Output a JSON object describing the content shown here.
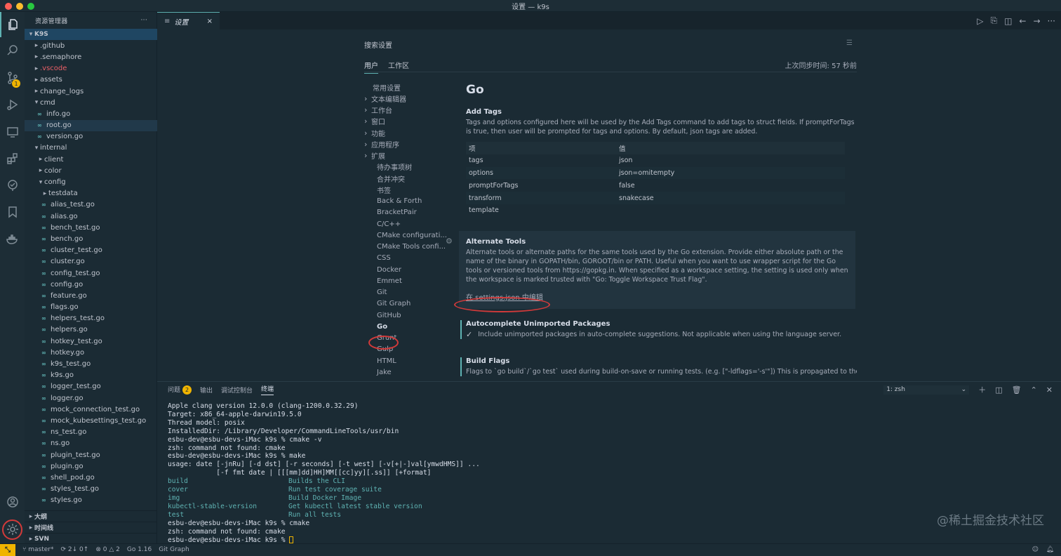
{
  "window": {
    "title": "设置 — k9s"
  },
  "explorer": {
    "header": "资源管理器",
    "more": "···",
    "root": "K9S",
    "items": [
      ".github",
      ".semaphore",
      ".vscode",
      "assets",
      "change_logs",
      "cmd",
      "info.go",
      "root.go",
      "version.go",
      "internal",
      "client",
      "color",
      "config",
      "testdata",
      "alias_test.go",
      "alias.go",
      "bench_test.go",
      "bench.go",
      "cluster_test.go",
      "cluster.go",
      "config_test.go",
      "config.go",
      "feature.go",
      "flags.go",
      "helpers_test.go",
      "helpers.go",
      "hotkey_test.go",
      "hotkey.go",
      "k9s_test.go",
      "k9s.go",
      "logger_test.go",
      "logger.go",
      "mock_connection_test.go",
      "mock_kubesettings_test.go",
      "ns_test.go",
      "ns.go",
      "plugin_test.go",
      "plugin.go",
      "shell_pod.go",
      "styles_test.go",
      "styles.go"
    ],
    "sections": [
      "大纲",
      "时间线",
      "SVN"
    ]
  },
  "activity": {
    "scm_badge": "1"
  },
  "editor": {
    "tab_label": "设置",
    "tab_close": "×"
  },
  "settings": {
    "search_placeholder": "搜索设置",
    "tab_user": "用户",
    "tab_workspace": "工作区",
    "sync_status": "上次同步时间: 57 秒前",
    "toc": [
      "常用设置",
      "文本编辑器",
      "工作台",
      "窗口",
      "功能",
      "应用程序",
      "扩展",
      "待办事项树",
      "合并冲突",
      "书签",
      "Back & Forth",
      "BracketPair",
      "C/C++",
      "CMake configurati...",
      "CMake Tools confi...",
      "CSS",
      "Docker",
      "Emmet",
      "Git",
      "Git Graph",
      "GitHub",
      "Go",
      "Grunt",
      "Gulp",
      "HTML",
      "Jake"
    ],
    "section_title": "Go",
    "add_tags": {
      "title": "Add Tags",
      "description": "Tags and options configured here will be used by the Add Tags command to add tags to struct fields. If promptForTags is true, then user will be prompted for tags and options. By default, json tags are added.",
      "col_key": "项",
      "col_value": "值",
      "rows": [
        {
          "k": "tags",
          "v": "json"
        },
        {
          "k": "options",
          "v": "json=omitempty"
        },
        {
          "k": "promptForTags",
          "v": "false"
        },
        {
          "k": "transform",
          "v": "snakecase"
        },
        {
          "k": "template",
          "v": ""
        }
      ]
    },
    "alternate_tools": {
      "title": "Alternate Tools",
      "description": "Alternate tools or alternate paths for the same tools used by the Go extension. Provide either absolute path or the name of the binary in GOPATH/bin, GOROOT/bin or PATH. Useful when you want to use wrapper script for the Go tools or versioned tools from https://gopkg.in. When specified as a workspace setting, the setting is used only when the workspace is marked trusted with \"Go: Toggle Workspace Trust Flag\".",
      "link": "在 settings.json 中编辑"
    },
    "autocomplete": {
      "title": "Autocomplete Unimported Packages",
      "checkbox_label": "Include unimported packages in auto-complete suggestions. Not applicable when using the language server."
    },
    "build_flags": {
      "title": "Build Flags",
      "description": "Flags to `go build`/`go test` used during build-on-save or running tests. (e.g. [\"-ldflags='-s'\"]) This is propagated to the"
    }
  },
  "panel": {
    "tabs": [
      "问题",
      "输出",
      "调试控制台",
      "终端"
    ],
    "problems_count": "2",
    "shell": "1: zsh",
    "terminal_lines": [
      "Apple clang version 12.0.0 (clang-1200.0.32.29)",
      "Target: x86_64-apple-darwin19.5.0",
      "Thread model: posix",
      "InstalledDir: /Library/Developer/CommandLineTools/usr/bin",
      "esbu-dev@esbu-devs-iMac k9s % cmake -v",
      "zsh: command not found: cmake",
      "esbu-dev@esbu-devs-iMac k9s % make",
      "usage: date [-jnRu] [-d dst] [-r seconds] [-t west] [-v[+|-]val[ymwdHMS]] ...",
      "            [-f fmt date | [[[mm]dd]HH]MM[[cc]yy][.ss]] [+format]"
    ],
    "make_targets": [
      {
        "name": "build",
        "desc": "Builds the CLI"
      },
      {
        "name": "cover",
        "desc": "Run test coverage suite"
      },
      {
        "name": "img",
        "desc": "Build Docker Image"
      },
      {
        "name": "kubectl-stable-version",
        "desc": "Get kubectl latest stable version"
      },
      {
        "name": "test",
        "desc": "Run all tests"
      }
    ],
    "terminal_tail": [
      "esbu-dev@esbu-devs-iMac k9s % cmake",
      "zsh: command not found: cmake",
      "esbu-dev@esbu-devs-iMac k9s % "
    ]
  },
  "watermark": "@稀土掘金技术社区",
  "statusbar": {
    "branch": "master*",
    "sync": "2↓ 0↑",
    "errors": "0",
    "warnings": "2",
    "go_version": "Go 1.16",
    "git_graph": "Git Graph"
  },
  "colors": {
    "accent": "#5fb3b3",
    "badge": "#f0b400",
    "highlight": "#d23a3a",
    "background": "#1b2b34"
  }
}
